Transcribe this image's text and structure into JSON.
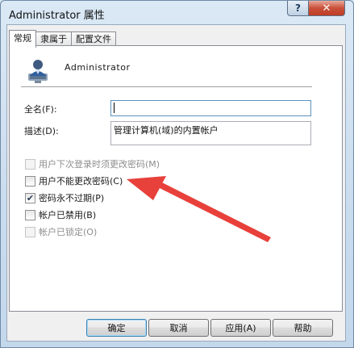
{
  "window": {
    "title": "Administrator 属性",
    "help_label": "?",
    "close_label": "✕"
  },
  "tabs": [
    {
      "label": "常规",
      "active": true
    },
    {
      "label": "隶属于",
      "active": false
    },
    {
      "label": "配置文件",
      "active": false
    }
  ],
  "user": {
    "name": "Administrator",
    "icon": "user-icon"
  },
  "fields": {
    "fullname_label": "全名(F):",
    "fullname_value": "",
    "description_label": "描述(D):",
    "description_value": "管理计算机(域)的内置帐户"
  },
  "options": [
    {
      "label": "用户下次登录时须更改密码(M)",
      "checked": false,
      "enabled": false
    },
    {
      "label": "用户不能更改密码(C)",
      "checked": false,
      "enabled": true
    },
    {
      "label": "密码永不过期(P)",
      "checked": true,
      "enabled": true
    },
    {
      "label": "帐户已禁用(B)",
      "checked": false,
      "enabled": true
    },
    {
      "label": "帐户已锁定(O)",
      "checked": false,
      "enabled": false
    }
  ],
  "buttons": {
    "ok": "确定",
    "cancel": "取消",
    "apply": "应用(A)",
    "help": "帮助"
  },
  "colors": {
    "annotation_arrow": "#e8403a",
    "close_button": "#c9503a"
  }
}
